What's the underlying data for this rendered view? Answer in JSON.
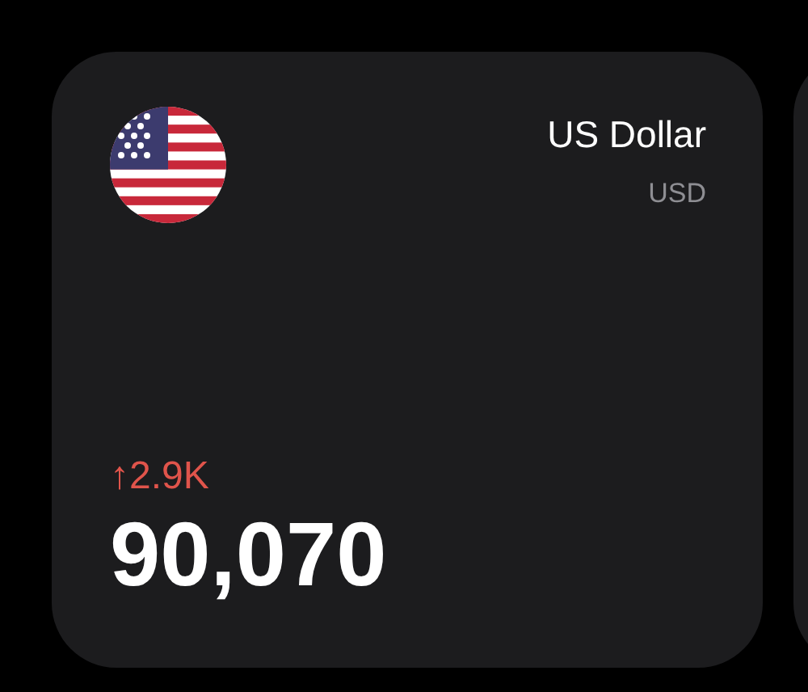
{
  "card": {
    "currency_name": "US Dollar",
    "currency_code": "USD",
    "change": {
      "text": "↑2.9K",
      "color": "#e0544b"
    },
    "amount": "90,070"
  }
}
